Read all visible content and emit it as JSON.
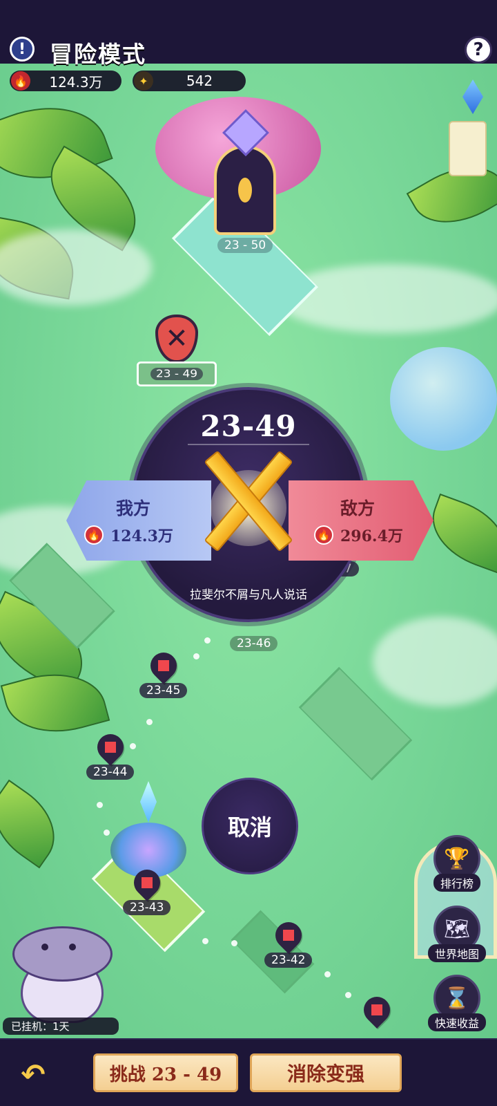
{
  "header": {
    "info_icon": "exclamation-icon",
    "title": "冒险模式",
    "help_icon": "question-icon"
  },
  "resources": {
    "power": {
      "icon": "fire-icon",
      "value": "124.3万"
    },
    "gems": {
      "icon": "star-crystal-icon",
      "value": "542"
    }
  },
  "map_nodes": {
    "boss": "23 - 50",
    "current": "23 - 49",
    "n47": "47",
    "n46": "23-46",
    "n45": "23-45",
    "n44": "23-44",
    "n43": "23-43",
    "n42": "23-42"
  },
  "battle": {
    "stage": "23-49",
    "my_label": "我方",
    "my_power": "124.3万",
    "enemy_label": "敌方",
    "enemy_power": "296.4万",
    "enemy_name": "拉斐尔不屑与凡人说话",
    "cancel_label": "取消"
  },
  "side_buttons": {
    "ranking": {
      "label": "排行榜",
      "icon": "trophy-icon"
    },
    "world_map": {
      "label": "世界地图",
      "icon": "map-icon"
    },
    "quick_income": {
      "label": "快速收益",
      "icon": "hourglass-icon"
    }
  },
  "idle": {
    "label": "已挂机：1天"
  },
  "bottom": {
    "back_icon": "back-arrow-icon",
    "challenge_label": "挑战 23 - 49",
    "upgrade_label": "消除变强"
  }
}
